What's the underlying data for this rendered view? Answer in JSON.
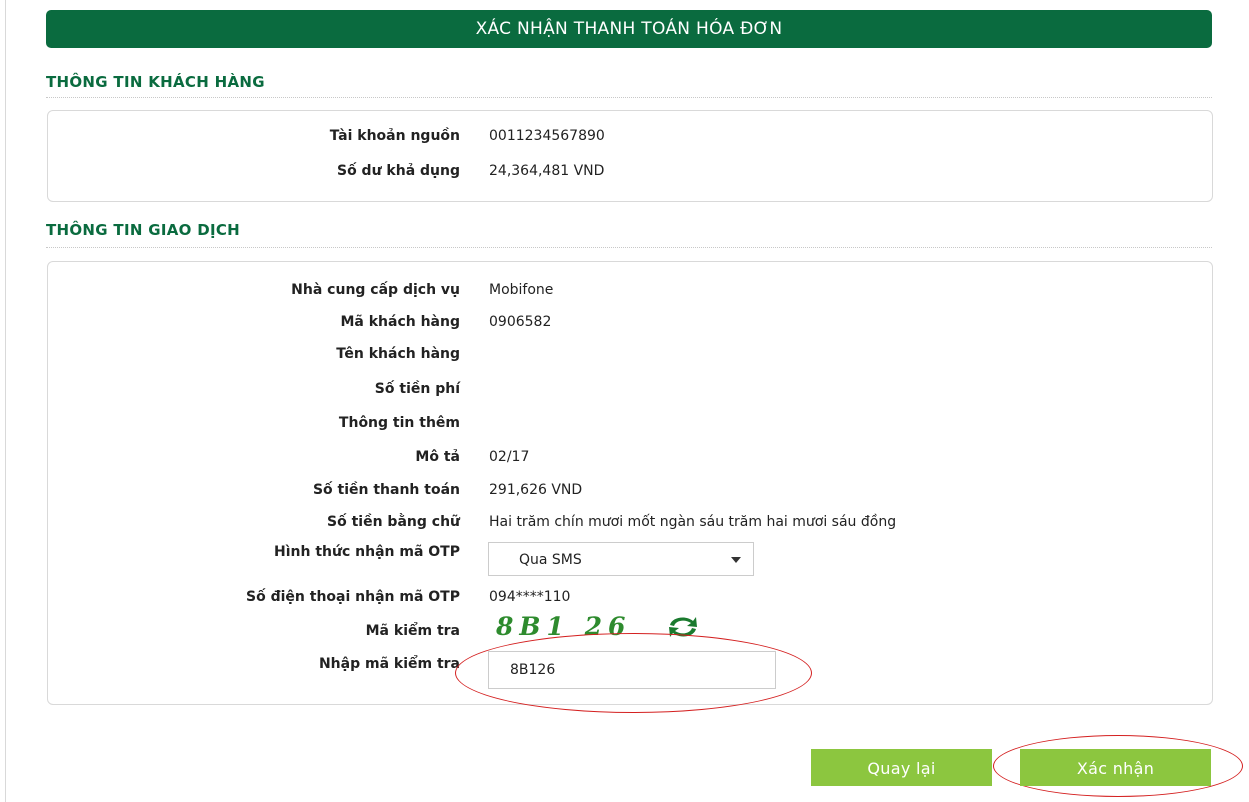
{
  "header": {
    "title": "XÁC NHẬN THANH TOÁN HÓA ĐƠN"
  },
  "customer_section": {
    "title": "THÔNG TIN KHÁCH HÀNG",
    "rows": [
      {
        "label": "Tài khoản nguồn",
        "value": "0011234567890"
      },
      {
        "label": "Số dư khả dụng",
        "value": "24,364,481 VND"
      }
    ]
  },
  "transaction_section": {
    "title": "THÔNG TIN GIAO DỊCH",
    "rows": [
      {
        "label": "Nhà cung cấp dịch vụ",
        "value": "Mobifone"
      },
      {
        "label": "Mã khách hàng",
        "value": "0906582"
      },
      {
        "label": "Tên khách hàng",
        "value": ""
      },
      {
        "label": "Số tiền phí",
        "value": ""
      },
      {
        "label": "Thông tin thêm",
        "value": ""
      },
      {
        "label": "Mô tả",
        "value": "02/17"
      },
      {
        "label": "Số tiền thanh toán",
        "value": "291,626 VND"
      },
      {
        "label": "Số tiền bằng chữ",
        "value": "Hai trăm chín mươi mốt ngàn sáu trăm hai mươi sáu đồng"
      },
      {
        "label": "Hình thức nhận mã OTP",
        "value": ""
      },
      {
        "label": "Số điện thoại nhận mã OTP",
        "value": "094****110"
      },
      {
        "label": "Mã kiểm tra",
        "value": ""
      },
      {
        "label": "Nhập mã kiểm tra",
        "value": ""
      }
    ],
    "otp_method_selected": "Qua SMS",
    "captcha_code": "8B1 26",
    "captcha_input_value": "8B126"
  },
  "buttons": {
    "back_label": "Quay lại",
    "confirm_label": "Xác nhận"
  },
  "colors": {
    "header_bg": "#0a6b3f",
    "section_title": "#0a6b3f",
    "button_bg": "#8cc63f",
    "captcha_text": "#2e8b2e",
    "annotation_red": "#d42020"
  },
  "icons": {
    "refresh": "refresh-icon",
    "dropdown": "chevron-down-icon"
  }
}
